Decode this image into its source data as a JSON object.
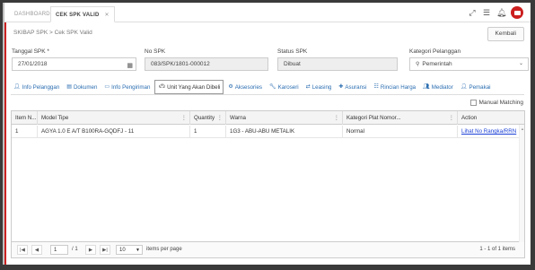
{
  "topbar": {
    "tabs": [
      {
        "label": "DASHBOARD",
        "active": false
      },
      {
        "label": "CEK SPK VALID",
        "active": true
      }
    ],
    "icons": [
      "fullscreen-icon",
      "menu-icon",
      "bell-icon",
      "user-avatar-icon"
    ]
  },
  "breadcrumb": {
    "text": "SKIBAP SPK > Cek SPK Valid"
  },
  "actions": {
    "back_label": "Kembali"
  },
  "form": {
    "tanggal_label": "Tanggal SPK *",
    "tanggal_value": "27/01/2018",
    "nospk_label": "No SPK",
    "nospk_value": "083/SPK/1801-000012",
    "status_label": "Status SPK",
    "status_value": "Dibuat",
    "kategori_label": "Kategori Pelanggan",
    "kategori_value": "Pemerintah"
  },
  "nav_tabs": [
    {
      "label": "Info Pelanggan",
      "icon": "user-icon",
      "active": false
    },
    {
      "label": "Dokumen",
      "icon": "document-icon",
      "active": false
    },
    {
      "label": "Info Pengiriman",
      "icon": "book-icon",
      "active": false
    },
    {
      "label": "Unit Yang Akan Dibeli",
      "icon": "car-icon",
      "active": true
    },
    {
      "label": "Aksesories",
      "icon": "gears-icon",
      "active": false
    },
    {
      "label": "Karoseri",
      "icon": "wrench-icon",
      "active": false
    },
    {
      "label": "Leasing",
      "icon": "handshake-icon",
      "active": false
    },
    {
      "label": "Asuransi",
      "icon": "plus-icon",
      "active": false
    },
    {
      "label": "Rincian Harga",
      "icon": "list-icon",
      "active": false
    },
    {
      "label": "Mediator",
      "icon": "users-icon",
      "active": false
    },
    {
      "label": "Pemakai",
      "icon": "person-icon",
      "active": false
    }
  ],
  "manual_matching": {
    "label": "Manual Matching",
    "checked": false
  },
  "grid": {
    "columns": [
      "Item N...",
      "Model Tipe",
      "Quantity",
      "Warna",
      "Kategori Plat Nomor...",
      "Action"
    ],
    "rows": [
      [
        "1",
        "AGYA 1.0 E A/T B100RA-GQDFJ - 11",
        "1",
        "1G3 - ABU-ABU METALIK",
        "Normal",
        "Lihat No Rangka/RRN"
      ]
    ]
  },
  "pager": {
    "page": "1",
    "of_pages": "/ 1",
    "page_size": "10",
    "items_per_page_label": "items per page",
    "summary": "1 - 1 of 1 items"
  }
}
